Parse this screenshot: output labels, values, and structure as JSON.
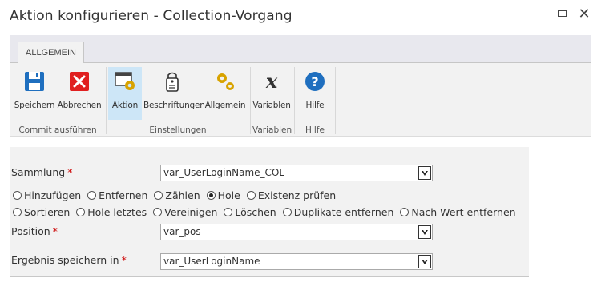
{
  "window": {
    "title": "Aktion konfigurieren - Collection-Vorgang"
  },
  "ribbon": {
    "tab": "ALLGEMEIN",
    "commands": {
      "save": "Speichern",
      "cancel": "Abbrechen",
      "action": "Aktion",
      "labels": "Beschriftungen",
      "general": "Allgemein",
      "variables": "Variablen",
      "help": "Hilfe"
    },
    "groups": {
      "commit": "Commit ausführen",
      "settings": "Einstellungen",
      "variables": "Variablen",
      "help": "Hilfe"
    }
  },
  "form": {
    "collection": {
      "label": "Sammlung",
      "value": "var_UserLoginName_COL"
    },
    "operations": [
      {
        "label": "Hinzufügen",
        "checked": false
      },
      {
        "label": "Entfernen",
        "checked": false
      },
      {
        "label": "Zählen",
        "checked": false
      },
      {
        "label": "Hole",
        "checked": true
      },
      {
        "label": "Existenz prüfen",
        "checked": false
      },
      {
        "label": "Sortieren",
        "checked": false
      },
      {
        "label": "Hole letztes",
        "checked": false
      },
      {
        "label": "Vereinigen",
        "checked": false
      },
      {
        "label": "Löschen",
        "checked": false
      },
      {
        "label": "Duplikate entfernen",
        "checked": false
      },
      {
        "label": "Nach Wert entfernen",
        "checked": false
      }
    ],
    "position": {
      "label": "Position",
      "value": "var_pos"
    },
    "result": {
      "label": "Ergebnis speichern in",
      "value": "var_UserLoginName"
    },
    "required_mark": "*"
  },
  "colors": {
    "accent": "#1f6fbf",
    "selected": "#cde6f7",
    "cancel_red": "#e02020",
    "gear": "#d8a300"
  }
}
